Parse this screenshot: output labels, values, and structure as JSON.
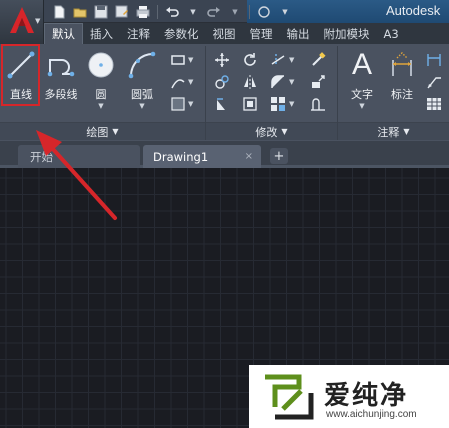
{
  "window": {
    "title": "Autodesk"
  },
  "quick_access": {
    "icons": [
      "new-icon",
      "open-icon",
      "save-icon",
      "save-as-icon",
      "print-icon",
      "undo-icon",
      "redo-icon",
      "workspace-icon"
    ]
  },
  "ribbon_tabs": [
    {
      "label": "默认",
      "active": true
    },
    {
      "label": "插入"
    },
    {
      "label": "注释"
    },
    {
      "label": "参数化"
    },
    {
      "label": "视图"
    },
    {
      "label": "管理"
    },
    {
      "label": "输出"
    },
    {
      "label": "附加模块"
    },
    {
      "label": "A3"
    }
  ],
  "draw_panel": {
    "title": "绘图",
    "tools": [
      {
        "label": "直线",
        "icon": "line-icon",
        "highlighted": true
      },
      {
        "label": "多段线",
        "icon": "polyline-icon"
      },
      {
        "label": "圆",
        "icon": "circle-icon"
      },
      {
        "label": "圆弧",
        "icon": "arc-icon"
      }
    ]
  },
  "modify_panel": {
    "title": "修改"
  },
  "annotation_panel": {
    "title": "注释",
    "tools": [
      {
        "label": "文字",
        "icon": "text-icon"
      },
      {
        "label": "标注",
        "icon": "dimension-icon"
      }
    ]
  },
  "document_tabs": {
    "start_label": "开始",
    "drawing_label": "Drawing1",
    "close_glyph": "×",
    "add_glyph": "+"
  },
  "watermark": {
    "text": "爱纯净",
    "url": "www.aichunjing.com"
  },
  "colors": {
    "highlight": "#d6262a",
    "canvas_bg": "#1a1c22",
    "ribbon_bg": "#4a5260"
  }
}
